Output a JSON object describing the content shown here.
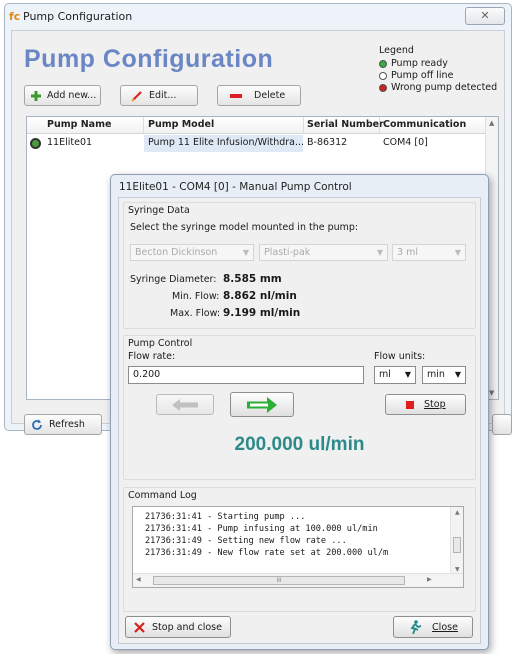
{
  "outer": {
    "logo": "fc",
    "title": "Pump Configuration",
    "close_glyph": "✕"
  },
  "main": {
    "heading": "Pump Configuration",
    "toolbar": {
      "add_label": "Add new...",
      "edit_label": "Edit...",
      "delete_label": "Delete"
    },
    "legend": {
      "title": "Legend",
      "items": [
        {
          "label": "Pump ready",
          "color": "#3aaa35"
        },
        {
          "label": "Pump off line",
          "color": "#ffffff"
        },
        {
          "label": "Wrong pump detected",
          "color": "#d21f1f"
        }
      ]
    },
    "table": {
      "columns": [
        "Pump Name",
        "Pump Model",
        "Serial Number",
        "Communication"
      ],
      "rows": [
        {
          "name": "11Elite01",
          "model": "Pump 11 Elite Infusion/Withdra...",
          "serial": "B-86312",
          "comm": "COM4 [0]"
        }
      ]
    },
    "refresh_label": "Refresh"
  },
  "dialog": {
    "title": "11Elite01 - COM4 [0] - Manual Pump Control",
    "syringe": {
      "group_title": "Syringe Data",
      "instruction": "Select the syringe model mounted in the pump:",
      "manufacturer": "Becton Dickinson",
      "model": "Plasti-pak",
      "volume": "3 ml",
      "diameter_label": "Syringe Diameter:",
      "diameter_value": "8.585 mm",
      "min_flow_label": "Min. Flow:",
      "min_flow_value": "8.862 nl/min",
      "max_flow_label": "Max. Flow:",
      "max_flow_value": "9.199 ml/min"
    },
    "control": {
      "group_title": "Pump Control",
      "flow_rate_label": "Flow rate:",
      "flow_rate_value": "0.200",
      "flow_units_label": "Flow units:",
      "unit_volume": "ml",
      "unit_time": "min",
      "stop_label": "Stop",
      "current_flow": "200.000 ul/min"
    },
    "log": {
      "title": "Command Log",
      "lines": [
        "21736:31:41 - Starting pump ...",
        "21736:31:41 - Pump infusing at 100.000 ul/min",
        "21736:31:49 - Setting new flow rate ...",
        "21736:31:49 - New flow rate set at 200.000 ul/m"
      ],
      "hscroll_grip": "III"
    },
    "stop_close_label": "Stop and close",
    "close_label": "Close"
  }
}
